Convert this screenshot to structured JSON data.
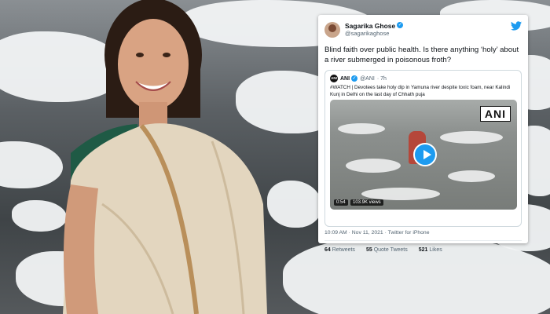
{
  "tweet": {
    "display_name": "Sagarika Ghose",
    "handle": "@sagarikaghose",
    "text": "Blind faith over public health. Is there anything ‘holy’ about a river submerged in poisonous froth?",
    "quoted": {
      "avatar_label": "ANI",
      "name": "ANI",
      "handle": "@ANI",
      "time": "· 7h",
      "text": "#WATCH | Devotees take holy dip in Yamuna river despite toxic foam, near Kalindi Kunj in Delhi on the last day of Chhath puja",
      "video_logo": "ANI",
      "duration": "0:54",
      "views": "103.9K views"
    },
    "meta": "10:09 AM · Nov 11, 2021 · Twitter for iPhone",
    "retweets_count": "64",
    "retweets_label": "Retweets",
    "quotes_count": "55",
    "quotes_label": "Quote Tweets",
    "likes_count": "521",
    "likes_label": "Likes"
  },
  "colors": {
    "accent": "#1d9bf0",
    "text": "#0f1419",
    "muted": "#536471"
  }
}
